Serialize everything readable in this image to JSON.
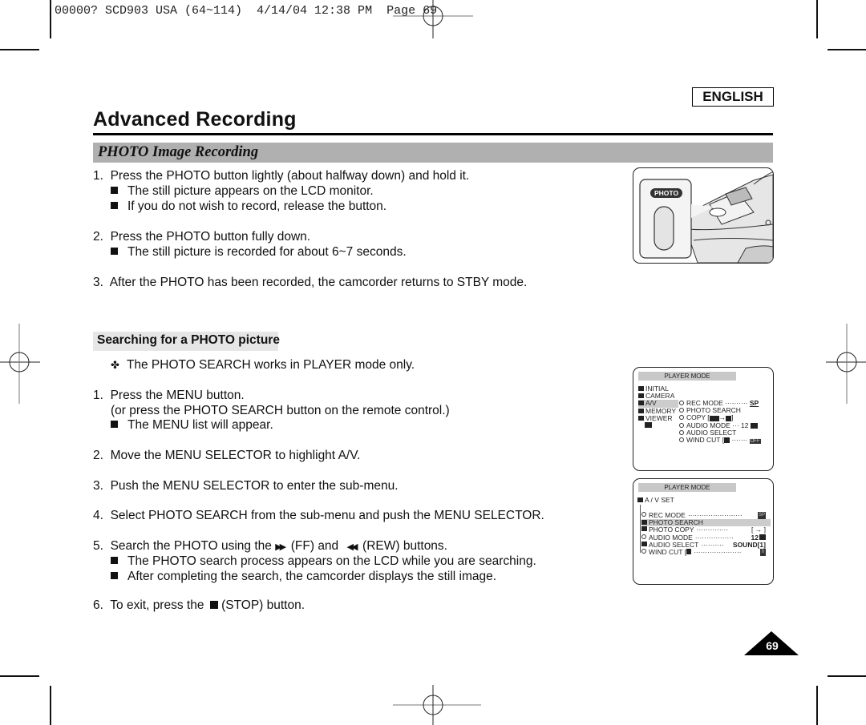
{
  "print_header": "00000? SCD903 USA (64~114)  4/14/04 12:38 PM  Page 69",
  "language_badge": "ENGLISH",
  "page_title": "Advanced Recording",
  "section1": {
    "title": "PHOTO Image Recording",
    "steps": [
      {
        "num": "1.",
        "text": "Press the PHOTO button lightly (about halfway down) and hold it.",
        "bullets": [
          "The still picture appears on the LCD monitor.",
          "If you do not wish to record, release the button."
        ]
      },
      {
        "num": "2.",
        "text": "Press the PHOTO button fully down.",
        "bullets": [
          "The still picture is recorded for about 6~7 seconds."
        ]
      },
      {
        "num": "3.",
        "text": "After the PHOTO has been recorded, the camcorder returns to STBY mode.",
        "bullets": []
      }
    ],
    "figure_label": "PHOTO"
  },
  "section2": {
    "title": "Searching for a PHOTO picture",
    "note": "The PHOTO SEARCH works in PLAYER mode only.",
    "steps": [
      {
        "num": "1.",
        "text": "Press the MENU button.",
        "sub": "(or press the PHOTO SEARCH button on the remote control.)",
        "bullets": [
          "The MENU list will appear."
        ]
      },
      {
        "num": "2.",
        "text": "Move the MENU SELECTOR to highlight A/V."
      },
      {
        "num": "3.",
        "text": "Push the MENU SELECTOR to enter the sub-menu."
      },
      {
        "num": "4.",
        "text": "Select PHOTO SEARCH from the sub-menu and push the MENU SELECTOR."
      },
      {
        "num": "5.",
        "text_a": "Search the PHOTO using the",
        "text_b": "(FF) and",
        "text_c": "(REW) buttons.",
        "bullets": [
          "The PHOTO search process appears on the LCD while you are searching.",
          "After completing the search, the camcorder displays the still image."
        ]
      },
      {
        "num": "6.",
        "text_a": "To exit, press the",
        "text_b": "(STOP) button."
      }
    ]
  },
  "menu1": {
    "header": "PLAYER  MODE",
    "left_items": [
      "INITIAL",
      "CAMERA",
      "A/V",
      "MEMORY",
      "VIEWER"
    ],
    "right_items": [
      {
        "label": "REC MODE",
        "dots": "··········",
        "value": "SP"
      },
      {
        "label": "PHOTO SEARCH",
        "dots": "",
        "value": ""
      },
      {
        "label": "COPY [",
        "dots": "",
        "value": "]"
      },
      {
        "label": "AUDIO MODE",
        "dots": "···",
        "value": "12"
      },
      {
        "label": "AUDIO SELECT",
        "dots": "",
        "value": ""
      },
      {
        "label": "WIND CUT [",
        "dots": "·······",
        "value": "OFF"
      }
    ]
  },
  "menu2": {
    "header": "PLAYER  MODE",
    "group": "A / V SET",
    "items": [
      {
        "label": "REC MODE",
        "dots": "························",
        "value": "SP"
      },
      {
        "label": "PHOTO SEARCH",
        "dots": "",
        "value": ""
      },
      {
        "label": "PHOTO COPY",
        "dots": "··············",
        "value": "[  →  ]"
      },
      {
        "label": "AUDIO MODE",
        "dots": "·················",
        "value": "12"
      },
      {
        "label": "AUDIO SELECT",
        "dots": "··········",
        "value": "SOUND[1]"
      },
      {
        "label": "WIND CUT [",
        "dots": "·····················",
        "value": "II"
      }
    ]
  },
  "page_number": "69"
}
